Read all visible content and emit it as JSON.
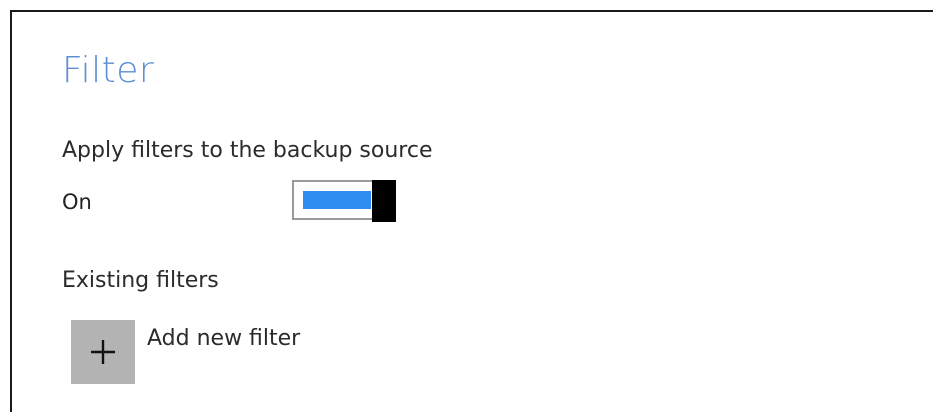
{
  "panel": {
    "title": "Filter",
    "apply_filters": {
      "label": "Apply filters to the backup source",
      "state_text": "On",
      "enabled": true
    },
    "existing_filters": {
      "label": "Existing filters",
      "add_button_label": "Add new filter",
      "add_icon": "plus-icon"
    }
  },
  "colors": {
    "title": "#5b8ed6",
    "toggle_fill": "#2f8cf0",
    "toggle_knob": "#000000",
    "add_button_bg": "#b3b3b3"
  }
}
